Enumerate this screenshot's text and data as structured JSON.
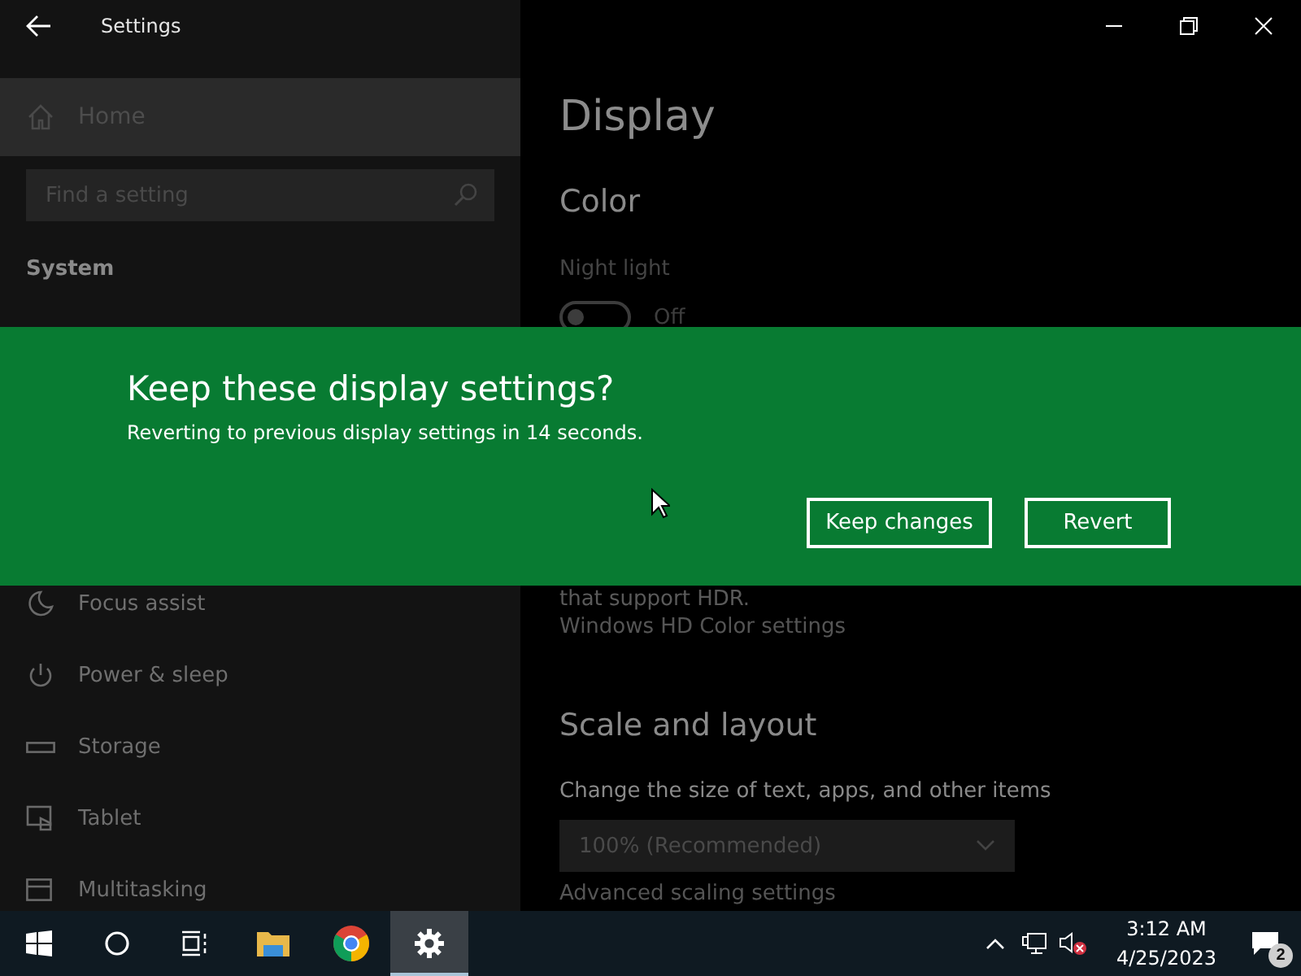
{
  "window": {
    "title": "Settings"
  },
  "sidebar": {
    "home": "Home",
    "search": {
      "placeholder": "Find a setting"
    },
    "section": "System",
    "items": [
      {
        "label": "Focus assist",
        "kind": "moon"
      },
      {
        "label": "Power & sleep",
        "kind": "power"
      },
      {
        "label": "Storage",
        "kind": "storage"
      },
      {
        "label": "Tablet",
        "kind": "tablet"
      },
      {
        "label": "Multitasking",
        "kind": "multitask"
      }
    ]
  },
  "content": {
    "title": "Display",
    "color_heading": "Color",
    "night_light": {
      "label": "Night light",
      "on": false,
      "state_text": "Off"
    },
    "hdr_note": "that support HDR.",
    "hdr_link": "Windows HD Color settings",
    "scale_heading": "Scale and layout",
    "scale_label": "Change the size of text, apps, and other items",
    "scale_value": "100% (Recommended)",
    "advanced_link": "Advanced scaling settings"
  },
  "dialog": {
    "title": "Keep these display settings?",
    "message": "Reverting to previous display settings in 14 seconds.",
    "buttons": [
      "Keep changes",
      "Revert"
    ]
  },
  "taskbar": {
    "apps": [
      {
        "kind": "start",
        "selected": false
      },
      {
        "kind": "search",
        "selected": false
      },
      {
        "kind": "taskview",
        "selected": false
      },
      {
        "kind": "explorer",
        "selected": false
      },
      {
        "kind": "chrome",
        "selected": false
      },
      {
        "kind": "settings",
        "selected": true
      }
    ],
    "time": "3:12 AM",
    "date": "4/25/2023",
    "notifications": "2"
  }
}
